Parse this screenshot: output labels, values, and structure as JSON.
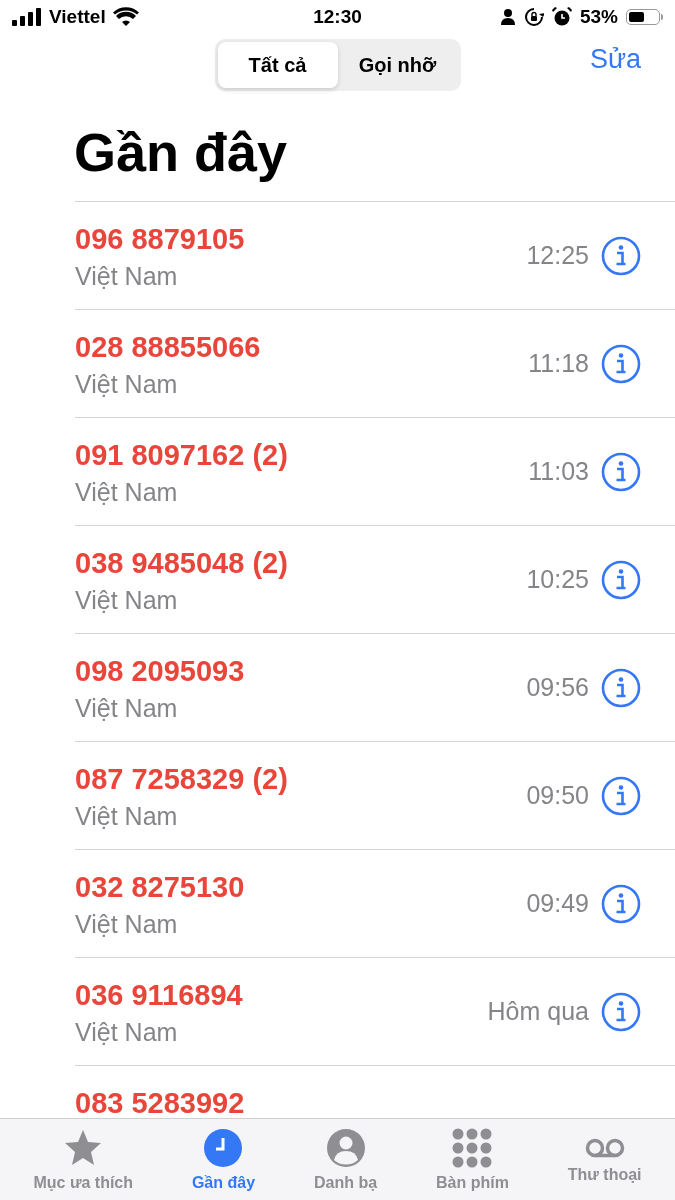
{
  "status_bar": {
    "carrier": "Viettel",
    "time": "12:30",
    "battery": "53%"
  },
  "segments": [
    {
      "label": "Tất cả",
      "selected": true
    },
    {
      "label": "Gọi nhỡ",
      "selected": false
    }
  ],
  "edit_button": "Sửa",
  "title": "Gần đây",
  "calls": [
    {
      "number": "096 8879105",
      "country": "Việt Nam",
      "time": "12:25",
      "missed": true
    },
    {
      "number": "028 88855066",
      "country": "Việt Nam",
      "time": "11:18",
      "missed": true
    },
    {
      "number": "091 8097162 (2)",
      "country": "Việt Nam",
      "time": "11:03",
      "missed": true
    },
    {
      "number": "038 9485048 (2)",
      "country": "Việt Nam",
      "time": "10:25",
      "missed": true
    },
    {
      "number": "098 2095093",
      "country": "Việt Nam",
      "time": "09:56",
      "missed": true
    },
    {
      "number": "087 7258329 (2)",
      "country": "Việt Nam",
      "time": "09:50",
      "missed": true
    },
    {
      "number": "032 8275130",
      "country": "Việt Nam",
      "time": "09:49",
      "missed": true
    },
    {
      "number": "036 9116894",
      "country": "Việt Nam",
      "time": "Hôm qua",
      "missed": true
    },
    {
      "number": "083 5283992",
      "missed": true
    }
  ],
  "tab_bar": [
    {
      "kind": "star",
      "label": "Mục ưa thích",
      "selected": false
    },
    {
      "kind": "clock",
      "label": "Gần đây",
      "selected": true
    },
    {
      "kind": "person",
      "label": "Danh bạ",
      "selected": false
    },
    {
      "kind": "keypad",
      "label": "Bàn phím",
      "selected": false
    },
    {
      "kind": "voicemail",
      "label": "Thư thoại",
      "selected": false
    }
  ]
}
